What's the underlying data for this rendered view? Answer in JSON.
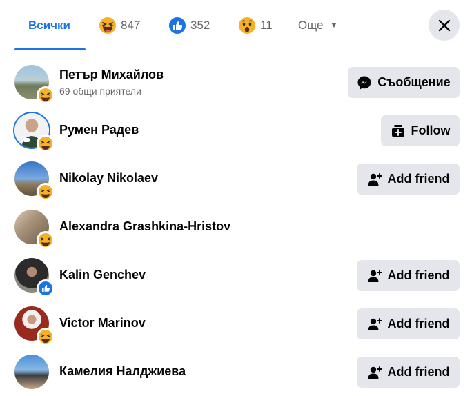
{
  "tabs": {
    "all_label": "Всички",
    "haha_count": "847",
    "like_count": "352",
    "wow_count": "11",
    "more_label": "Още"
  },
  "people": [
    {
      "name": "Петър Михайлов",
      "subtitle": "69 общи приятели",
      "reaction": "haha-icon",
      "action": "Съобщение",
      "action_icon": "messenger-icon"
    },
    {
      "name": "Румен Радев",
      "subtitle": "",
      "reaction": "haha-icon",
      "action": "Follow",
      "action_icon": "follow-icon"
    },
    {
      "name": "Nikolay Nikolaev",
      "subtitle": "",
      "reaction": "haha-icon",
      "action": "Add friend",
      "action_icon": "add-friend-icon"
    },
    {
      "name": "Alexandra Grashkina-Hristov",
      "subtitle": "",
      "reaction": "haha-icon",
      "action": "",
      "action_icon": ""
    },
    {
      "name": "Kalin Genchev",
      "subtitle": "",
      "reaction": "like-icon",
      "action": "Add friend",
      "action_icon": "add-friend-icon"
    },
    {
      "name": "Victor Marinov",
      "subtitle": "",
      "reaction": "haha-icon",
      "action": "Add friend",
      "action_icon": "add-friend-icon"
    },
    {
      "name": "Камелия Налджиева",
      "subtitle": "",
      "reaction": "haha-icon",
      "action": "Add friend",
      "action_icon": "add-friend-icon"
    }
  ],
  "colors": {
    "accent": "#1b74e4",
    "button_bg": "#e4e6eb",
    "secondary_text": "#65676b"
  }
}
